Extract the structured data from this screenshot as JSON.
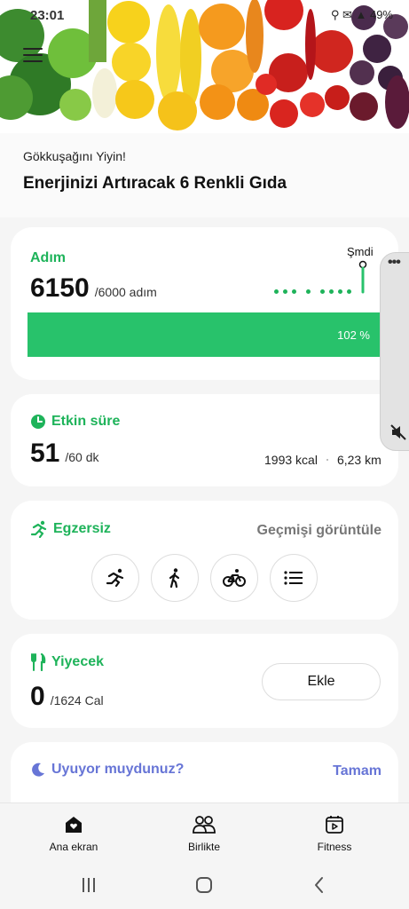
{
  "status_bar": {
    "time": "23:01",
    "right": "⚲ ✉ ▲ 49%"
  },
  "hero": {
    "subtitle": "Gökkuşağını Yiyin!",
    "title": "Enerjinizi Artıracak 6 Renkli Gıda"
  },
  "steps": {
    "title": "Adım",
    "value": "6150",
    "goal": "/6000 adım",
    "now_label": "Şmdi",
    "progress_label": "102 %",
    "progress_fraction": 1.02
  },
  "active_time": {
    "title": "Etkin süre",
    "value": "51",
    "goal": "/60 dk",
    "kcal": "1993 kcal",
    "distance": "6,23 km"
  },
  "exercise": {
    "title": "Egzersiz",
    "history_link": "Geçmişi görüntüle",
    "buttons": [
      "running-icon",
      "walking-icon",
      "cycling-icon",
      "list-icon"
    ]
  },
  "food": {
    "title": "Yiyecek",
    "value": "0",
    "goal": "/1624 Cal",
    "add_label": "Ekle"
  },
  "sleep": {
    "title": "Uyuyor muydunuz?",
    "done_label": "Tamam"
  },
  "bottom_nav": {
    "items": [
      {
        "label": "Ana ekran",
        "icon": "home-icon"
      },
      {
        "label": "Birlikte",
        "icon": "people-icon"
      },
      {
        "label": "Fitness",
        "icon": "fitness-icon"
      }
    ]
  },
  "colors": {
    "accent_green": "#1eb35a",
    "bar_green": "#28c26b",
    "sleep_purple": "#6775d6"
  }
}
